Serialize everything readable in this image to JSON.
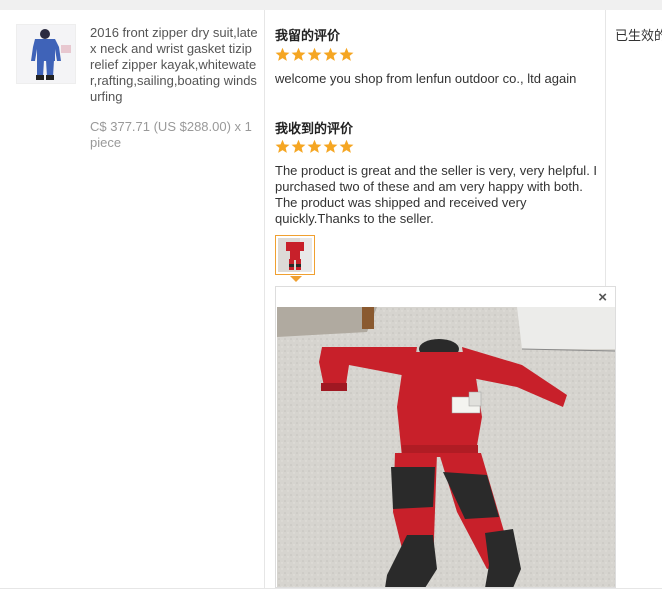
{
  "product": {
    "title": "2016 front zipper dry suit,latex neck and wrist gasket tizip relief zipper kayak,whitewater,rafting,sailing,boating windsurfing",
    "price": "C$ 377.71 (US $288.00) x 1 piece"
  },
  "my_feedback": {
    "heading": "我留的评价",
    "rating": 5,
    "text": "welcome you shop from lenfun outdoor co., ltd again"
  },
  "received_feedback": {
    "heading": "我收到的评价",
    "rating": 5,
    "text": "The product is great and the seller is very, very helpful. I purchased two of these and am very happy with both. The product was shipped and received very quickly.Thanks to the seller."
  },
  "photo_viewer": {
    "close_label": "×"
  },
  "status": {
    "text": "已生效的"
  },
  "colors": {
    "star": "#f5a623",
    "thumb_border": "#f0a030",
    "suit_red": "#c8202a",
    "suit_black": "#2a2a2a",
    "carpet": "#d8d6d0"
  }
}
